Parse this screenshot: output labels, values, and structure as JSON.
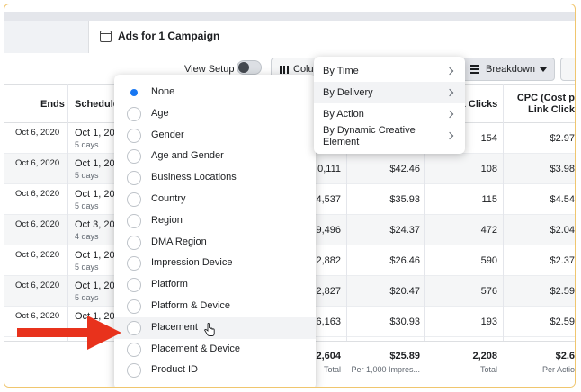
{
  "tab": {
    "title": "Ads for 1 Campaign"
  },
  "toolbar": {
    "view_setup": "View Setup",
    "columns_label": "Colu",
    "breakdown_label": "Breakdown"
  },
  "table": {
    "headers": {
      "ends": "Ends",
      "schedule": "Schedule",
      "link_clicks": "nk Clicks",
      "cpc_line1": "CPC (Cost p",
      "cpc_line2": "Link Click"
    },
    "rows": [
      {
        "ends": "Oct 6, 2020",
        "schedule": "Oct 1, 202",
        "days": "5 days",
        "impr": "",
        "cost": "",
        "clicks": "154",
        "cpc": "$2.97"
      },
      {
        "ends": "Oct 6, 2020",
        "schedule": "Oct 1, 202",
        "days": "5 days",
        "impr": "0,111",
        "cost": "$42.46",
        "clicks": "108",
        "cpc": "$3.98"
      },
      {
        "ends": "Oct 6, 2020",
        "schedule": "Oct 1, 202",
        "days": "5 days",
        "impr": "4,537",
        "cost": "$35.93",
        "clicks": "115",
        "cpc": "$4.54"
      },
      {
        "ends": "Oct 6, 2020",
        "schedule": "Oct 3, 202",
        "days": "4 days",
        "impr": "9,496",
        "cost": "$24.37",
        "clicks": "472",
        "cpc": "$2.04"
      },
      {
        "ends": "Oct 6, 2020",
        "schedule": "Oct 1, 202",
        "days": "5 days",
        "impr": "2,882",
        "cost": "$26.46",
        "clicks": "590",
        "cpc": "$2.37"
      },
      {
        "ends": "Oct 6, 2020",
        "schedule": "Oct 1, 202",
        "days": "5 days",
        "impr": "2,827",
        "cost": "$20.47",
        "clicks": "576",
        "cpc": "$2.59"
      },
      {
        "ends": "Oct 6, 2020",
        "schedule": "Oct 1, 202",
        "days": "",
        "impr": "6,163",
        "cost": "$30.93",
        "clicks": "193",
        "cpc": "$2.59"
      }
    ],
    "totals": {
      "impr": "22,604",
      "impr_sub": "Total",
      "cost": "$25.89",
      "cost_sub": "Per 1,000 Impres...",
      "clicks": "2,208",
      "clicks_sub": "Total",
      "cpc": "$2.6",
      "cpc_sub": "Per Actio"
    }
  },
  "breakdown_options": [
    {
      "label": "None",
      "selected": true
    },
    {
      "label": "Age"
    },
    {
      "label": "Gender"
    },
    {
      "label": "Age and Gender"
    },
    {
      "label": "Business Locations"
    },
    {
      "label": "Country"
    },
    {
      "label": "Region"
    },
    {
      "label": "DMA Region"
    },
    {
      "label": "Impression Device"
    },
    {
      "label": "Platform"
    },
    {
      "label": "Platform & Device"
    },
    {
      "label": "Placement",
      "hovered": true
    },
    {
      "label": "Placement & Device"
    },
    {
      "label": "Product ID"
    }
  ],
  "submenu": [
    {
      "label": "By Time"
    },
    {
      "label": "By Delivery",
      "active": true
    },
    {
      "label": "By Action"
    },
    {
      "label": "By Dynamic Creative Element"
    }
  ],
  "colors": {
    "accent": "#1877f2",
    "arrow": "#e8321c",
    "frame": "#f0c66e"
  },
  "icons": {
    "tab": "window-icon",
    "columns": "columns-icon",
    "breakdown": "breakdown-icon",
    "cursor": "hand-pointer-icon",
    "annotation": "red-arrow-icon"
  }
}
